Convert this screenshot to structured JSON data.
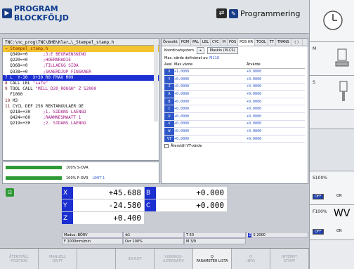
{
  "header": {
    "left_mode": "PROGRAM BLOCKFÖLJD",
    "right_mode": "Programmering"
  },
  "program": {
    "path": "TNC:\\nc_prog\\TNC\\BHB\\Klar…\\_Stempel_stamp.h",
    "file": "→_Stempel_stamp.h",
    "lines": [
      {
        "num": "",
        "code": "  Q349=+0      ",
        "comment": ";3:E BEGRAENSNING",
        "sel": false
      },
      {
        "num": "",
        "code": "  Q220=+0      ",
        "comment": ";HOERNRADIE",
        "sel": false
      },
      {
        "num": "",
        "code": "  Q368=+0      ",
        "comment": ";TILLAEGG SIDA",
        "sel": false
      },
      {
        "num": "",
        "code": "  Q338=+0      ",
        "comment": ";SKAERDJUP FINSKAER",
        "sel": false
      },
      {
        "num": "7",
        "code": " L  Y-30  X+30 R0 FMAX M99",
        "comment": "",
        "sel": true
      },
      {
        "num": "8",
        "code": " CALL LBL ",
        "comment": "\"safe\"",
        "sel": false
      },
      {
        "num": "9",
        "code": " TOOL CALL ",
        "comment": "\"MILL_D20_ROUGH\" Z S2000",
        "sel": false
      },
      {
        "num": "",
        "code": "  F1000",
        "comment": "",
        "sel": false
      },
      {
        "num": "10",
        "code": " M3",
        "comment": "",
        "sel": false
      },
      {
        "num": "11",
        "code": " CYCL DEF 256 REKTANGULAER OE",
        "comment": "",
        "sel": false
      },
      {
        "num": "",
        "code": "  Q218=+30     ",
        "comment": ";1. SIDANS LAENGD",
        "sel": false
      },
      {
        "num": "",
        "code": "  Q424=+60     ",
        "comment": ";RAAMNESMAATT 1",
        "sel": false
      },
      {
        "num": "",
        "code": "  Q219=+30     ",
        "comment": ";2. SIDANS LAENGD",
        "sel": false
      }
    ]
  },
  "overrides": {
    "s_label": "100% S-OVR",
    "f_label": "100% F-OVR",
    "f_limit": "LIMIT 1",
    "s_fill": 1.0,
    "f_fill": 1.0
  },
  "tabs": [
    "Översikt",
    "PGM",
    "PAL",
    "LBL",
    "CYC",
    "M",
    "POS",
    "POS HR",
    "TOOL",
    "TT",
    "TRANS"
  ],
  "tab_arrows": "〈 〉",
  "limits": {
    "koord_label": "Koordinatsystem",
    "koord_value": "Maskin (M-CS)",
    "maxdef_label": "Max.-värde definierat av:",
    "maxdef_value": "M118",
    "headers": [
      "Axel",
      "Max.värde",
      "Ärvärde"
    ],
    "rows": [
      {
        "axis": "X",
        "max": "+1.0000",
        "actual": "+0.0000"
      },
      {
        "axis": "Y",
        "max": "+0.0000",
        "actual": "+0.0000"
      },
      {
        "axis": "Z",
        "max": "+0.0000",
        "actual": "+0.0000"
      },
      {
        "axis": "A",
        "max": "+0.0000",
        "actual": "+0.0000"
      },
      {
        "axis": "B",
        "max": "+0.0000",
        "actual": "+0.0000"
      },
      {
        "axis": "C",
        "max": "+0.0000",
        "actual": "+0.0000"
      },
      {
        "axis": "U",
        "max": "+0.0000",
        "actual": "+0.0000"
      },
      {
        "axis": "V",
        "max": "+0.0000",
        "actual": "+0.0000"
      },
      {
        "axis": "W",
        "max": "+0.0000",
        "actual": "+0.0000"
      },
      {
        "axis": "VT",
        "max": "+0.0000",
        "actual": "+0.0000"
      }
    ],
    "reset_label": "Återställ VT-värde"
  },
  "positions": {
    "X": "+45.688",
    "Y": "-24.580",
    "Z": "+0.400",
    "B": "+0.000",
    "C": "+0.000",
    "indicator": "⊡"
  },
  "status": {
    "modus": "Modus: BÖRV",
    "spindle": "⊕1",
    "t": "T 50",
    "z_badge": "Z",
    "s": "S 2000",
    "feed": "F 1000mm/min",
    "ovr": "Ovr 100%",
    "m": "M 3/9"
  },
  "softkeys": [
    {
      "l1": "ÅTERSTÄLL",
      "l2": "POSITION",
      "on": false
    },
    {
      "l1": "MANUELL",
      "l2": "DRIFT",
      "on": false
    },
    {
      "l1": "",
      "l2": "",
      "on": false
    },
    {
      "l1": "3D-ROT",
      "l2": "",
      "on": false
    },
    {
      "l1": "VISNINGS-",
      "l2": "ALTERNATIV",
      "on": false
    },
    {
      "l1": "Q",
      "l2": "PARAMETER LISTA",
      "on": true
    },
    {
      "l1": "Q",
      "l2": "INFO",
      "on": false
    },
    {
      "l1": "INTERNT",
      "l2": "STOPP",
      "on": false
    }
  ],
  "right": {
    "m": "M",
    "s": "S",
    "s_ovr": "S100%",
    "f_ovr": "F100%",
    "off": "OFF",
    "on": "ON"
  }
}
